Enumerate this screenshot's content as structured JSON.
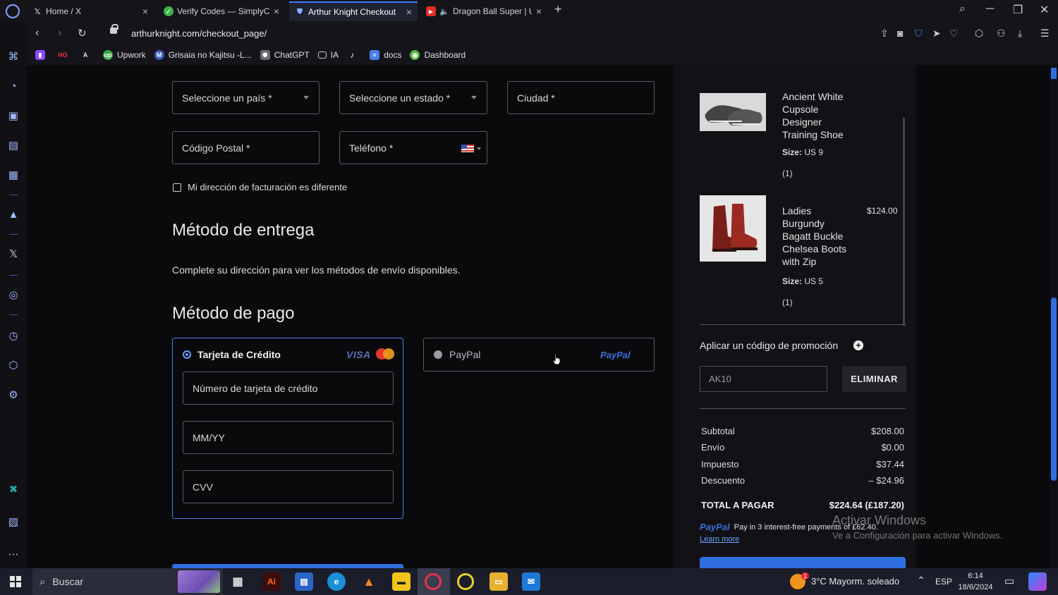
{
  "browser": {
    "tabs": [
      {
        "title": "Home / X"
      },
      {
        "title": "Verify Codes — SimplyCod"
      },
      {
        "title": "Arthur Knight Checkout"
      },
      {
        "title": "Dragon Ball Super | Ulti"
      }
    ],
    "new_tab": "+",
    "url": "arthurknight.com/checkout_page/",
    "bookmarks": [
      {
        "label": ""
      },
      {
        "label": ""
      },
      {
        "label": ""
      },
      {
        "label": "Upwork"
      },
      {
        "label": "Grisaia no Kajitsu -L..."
      },
      {
        "label": "ChatGPT"
      },
      {
        "label": "IA"
      },
      {
        "label": ""
      },
      {
        "label": "docs"
      },
      {
        "label": "Dashboard"
      }
    ]
  },
  "checkout": {
    "country_placeholder": "Seleccione un país *",
    "state_placeholder": "Seleccione un estado *",
    "city_placeholder": "Ciudad *",
    "postal_placeholder": "Código Postal *",
    "phone_placeholder": "Teléfono *",
    "billing_checkbox_label": "Mi dirección de facturación es diferente",
    "delivery_heading": "Método de entrega",
    "delivery_info": "Complete su dirección para ver los métodos de envío disponibles.",
    "payment_heading": "Método de pago",
    "credit_card_label": "Tarjeta de Crédito",
    "visa_logo": "VISA",
    "card_number_placeholder": "Número de tarjeta de crédito",
    "expiry_placeholder": "MM/YY",
    "cvv_placeholder": "CVV",
    "paypal_label": "PayPal",
    "paypal_logo": "PayPal"
  },
  "summary": {
    "items": [
      {
        "name": "Ancient White Cupsole Designer Training Shoe",
        "size_label": "Size:",
        "size": "US 9",
        "qty": "(1)",
        "price": ""
      },
      {
        "name": "Ladies Burgundy Bagatt Buckle Chelsea Boots with Zip",
        "size_label": "Size:",
        "size": "US 5",
        "qty": "(1)",
        "price": "$124.00"
      }
    ],
    "promo_title": "Aplicar un código de promoción",
    "promo_code": "AK10",
    "remove_button": "ELIMINAR",
    "rows": [
      {
        "label": "Subtotal",
        "value": "$208.00"
      },
      {
        "label": "Envío",
        "value": "$0.00"
      },
      {
        "label": "Impuesto",
        "value": "$37.44"
      },
      {
        "label": "Descuento",
        "value": "– $24.96"
      }
    ],
    "total_label": "TOTAL A PAGAR",
    "total_value": "$224.64 (£187.20)",
    "paypal_brand": "PayPal",
    "paypal_message": "Pay in 3 interest-free payments of £62.40.",
    "learn_more": "Learn more"
  },
  "watermark": {
    "line1": "Activar Windows",
    "line2": "Ve a Configuración para activar Windows."
  },
  "taskbar": {
    "search_placeholder": "Buscar",
    "weather": "3°C  Mayorm. soleado",
    "language": "ESP",
    "time": "6:14",
    "date": "18/6/2024",
    "notification_badge": "1"
  },
  "colors": {
    "accent": "#2f6fe0",
    "background": "#0a0a0d",
    "border": "#5a5a62"
  }
}
